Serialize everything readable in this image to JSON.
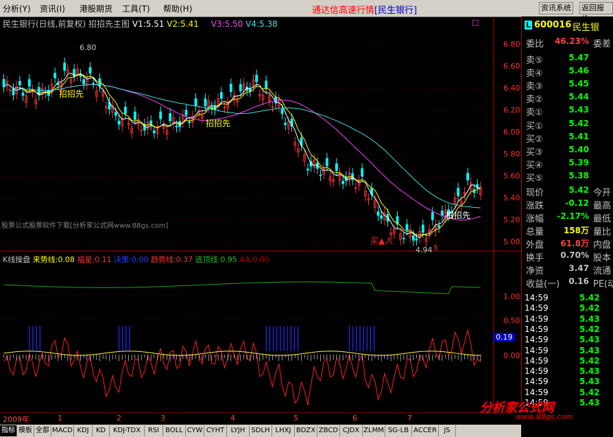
{
  "menubar": {
    "items": [
      "分析(Y)",
      "资讯(I)",
      "港股期货",
      "工具(T)",
      "帮助(H)"
    ],
    "title": "通达信高速行情",
    "stock_label": "[民生银行]",
    "buttons": [
      "资讯系统",
      "返回报价"
    ]
  },
  "main_chart": {
    "header_stock": "民生银行(日线,前复权)",
    "header_formula": "招招先主图",
    "v1": "V1:5.51",
    "v2": "V2:5.41",
    "v3": "V3:5.50",
    "v4": "V4:5.38",
    "price_ticks": [
      "6.80",
      "6.60",
      "6.40",
      "6.20",
      "6.00",
      "5.80",
      "5.60",
      "5.40",
      "5.20",
      "5.00"
    ],
    "high_label": "6.80",
    "low_label": "4.94",
    "signal_text": "招招先",
    "buy_text": "买▲入",
    "watermark": "股票公式股票软件下载[分析家公式网www.88gs.com]",
    "dollar": "$"
  },
  "indicator": {
    "name": "K线操盘",
    "lailong_label": "来势线:",
    "lailong": "0.08",
    "fuxing_label": "福星:",
    "fuxing": "0.11",
    "juece_label": "决策:",
    "juece": "0.00",
    "qushi_label": "趋势线:",
    "qushi": "0.37",
    "taoding_label": "逃顶线:",
    "taoding": "0.95",
    "aa_label": "AA:",
    "aa": "0.00",
    "ticks": [
      "1.00",
      "0.50",
      "0.00"
    ],
    "current": "0.19"
  },
  "quote": {
    "code": "600016",
    "name": "民生银",
    "code_badge": "L",
    "weibi_label": "委比",
    "weibi": "46.23%",
    "weicha_label": "委差",
    "sell": [
      {
        "label": "卖⑤",
        "price": "5.47"
      },
      {
        "label": "卖④",
        "price": "5.46"
      },
      {
        "label": "卖③",
        "price": "5.45"
      },
      {
        "label": "卖②",
        "price": "5.44"
      },
      {
        "label": "卖①",
        "price": "5.43"
      }
    ],
    "buy": [
      {
        "label": "买①",
        "price": "5.42"
      },
      {
        "label": "买②",
        "price": "5.41"
      },
      {
        "label": "买③",
        "price": "5.40"
      },
      {
        "label": "买④",
        "price": "5.39"
      },
      {
        "label": "买⑤",
        "price": "5.38"
      }
    ],
    "stats": [
      {
        "label": "现价",
        "value": "5.42",
        "extra": "今开",
        "color": "#00ff00"
      },
      {
        "label": "涨跌",
        "value": "-0.12",
        "extra": "最高",
        "color": "#00ff00"
      },
      {
        "label": "涨幅",
        "value": "-2.17%",
        "extra": "最低",
        "color": "#00ff00"
      },
      {
        "label": "总量",
        "value": "158万",
        "extra": "量比",
        "color": "#ffff00"
      },
      {
        "label": "外盘",
        "value": "61.8万",
        "extra": "内盘",
        "color": "#ff4040"
      },
      {
        "label": "换手",
        "value": "0.70%",
        "extra": "股本",
        "color": "#c0c0c0"
      },
      {
        "label": "净资",
        "value": "3.47",
        "extra": "流通",
        "color": "#c0c0c0"
      },
      {
        "label": "收益(一)",
        "value": "0.16",
        "extra": "PE(动",
        "color": "#c0c0c0"
      }
    ],
    "ticks": [
      {
        "time": "14:59",
        "price": "5.42"
      },
      {
        "time": "14:59",
        "price": "5.42"
      },
      {
        "time": "14:59",
        "price": "5.43"
      },
      {
        "time": "14:59",
        "price": "5.42"
      },
      {
        "time": "14:59",
        "price": "5.43"
      },
      {
        "time": "14:59",
        "price": "5.43"
      },
      {
        "time": "14:59",
        "price": "5.42"
      },
      {
        "time": "14:59",
        "price": "5.43"
      },
      {
        "time": "14:59",
        "price": "5.43"
      },
      {
        "time": "14:59",
        "price": "5.42"
      },
      {
        "time": "14:59",
        "price": "5.43"
      }
    ]
  },
  "datebar": {
    "items": [
      "2009年",
      "1",
      "2",
      "3",
      "4",
      "5",
      "6",
      "7"
    ]
  },
  "tabs": [
    "指标",
    "模板",
    "全部",
    "MACD",
    "KDJ",
    "KD",
    "KDJ-TDX",
    "RSI",
    "BOLL",
    "CYW",
    "CYHT",
    "LYJH",
    "SDLH",
    "LHXJ",
    "BDZX",
    "ZBCD",
    "CJDX",
    "ZLMM",
    "SG-LB",
    "ACCER",
    "JS"
  ],
  "watermark_site": "分析家公式网",
  "watermark_url": "www.88gs.com",
  "colors": {
    "up": "#ff3030",
    "down": "#00ffff",
    "ma_white": "#ffffff",
    "ma_yellow": "#ffff00",
    "ma_magenta": "#ff40ff",
    "ma_cyan": "#40e0e0"
  }
}
